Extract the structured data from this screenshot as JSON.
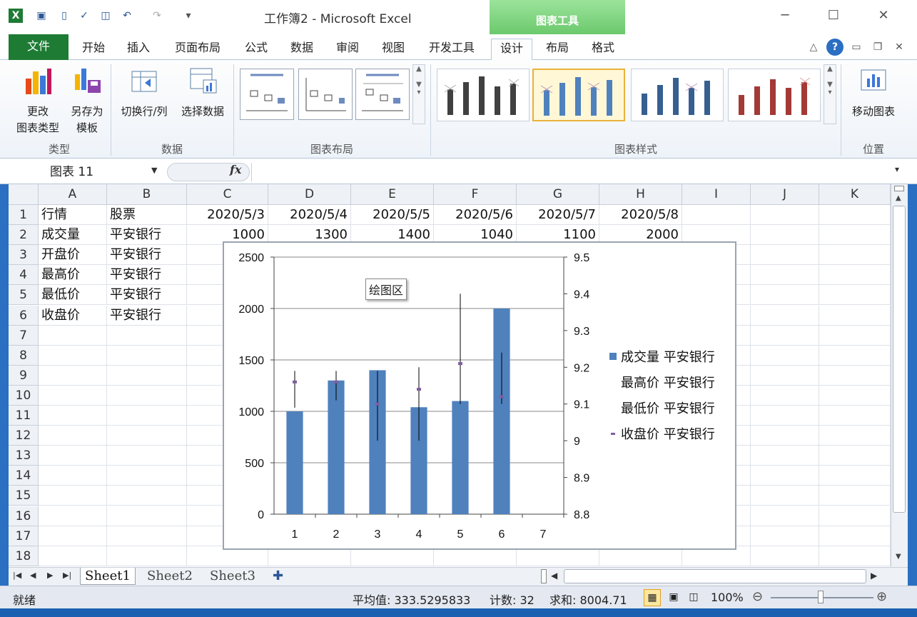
{
  "window": {
    "title": "工作簿2 - Microsoft Excel",
    "context_tab": "图表工具"
  },
  "ribbon_tabs": [
    "文件",
    "开始",
    "插入",
    "页面布局",
    "公式",
    "数据",
    "审阅",
    "视图",
    "开发工具",
    "设计",
    "布局",
    "格式"
  ],
  "active_tab": "设计",
  "ribbon": {
    "type_group": {
      "label": "类型",
      "change_type": [
        "更改",
        "图表类型"
      ],
      "save_template": [
        "另存为",
        "模板"
      ]
    },
    "data_group": {
      "label": "数据",
      "switch": "切换行/列",
      "select": "选择数据"
    },
    "layout_group": {
      "label": "图表布局"
    },
    "style_group": {
      "label": "图表样式"
    },
    "position_group": {
      "label": "位置",
      "move": "移动图表"
    }
  },
  "formula_bar": {
    "name_box": "图表 11",
    "fx": "fx",
    "formula": ""
  },
  "columns": [
    "A",
    "B",
    "C",
    "D",
    "E",
    "F",
    "G",
    "H",
    "I",
    "J",
    "K"
  ],
  "rows": [
    "1",
    "2",
    "3",
    "4",
    "5",
    "6",
    "7",
    "8",
    "9",
    "10",
    "11",
    "12",
    "13",
    "14",
    "15",
    "16",
    "17",
    "18"
  ],
  "cells": {
    "r1": [
      "行情",
      "股票",
      "2020/5/3",
      "2020/5/4",
      "2020/5/5",
      "2020/5/6",
      "2020/5/7",
      "2020/5/8"
    ],
    "r2": [
      "成交量",
      "平安银行",
      "1000",
      "1300",
      "1400",
      "1040",
      "1100",
      "2000"
    ],
    "r3": [
      "开盘价",
      "平安银行"
    ],
    "r4": [
      "最高价",
      "平安银行"
    ],
    "r5": [
      "最低价",
      "平安银行"
    ],
    "r6": [
      "收盘价",
      "平安银行"
    ]
  },
  "chart_data": {
    "type": "bar",
    "categories": [
      "1",
      "2",
      "3",
      "4",
      "5",
      "6",
      "7"
    ],
    "series": [
      {
        "name": "成交量 平安银行",
        "axis": "left",
        "values": [
          1000,
          1300,
          1400,
          1040,
          1100,
          2000,
          null
        ],
        "color": "#4f81bd"
      },
      {
        "name": "最高价 平安银行",
        "axis": "right",
        "values": [
          9.19,
          9.19,
          9.19,
          9.2,
          9.4,
          9.24,
          null
        ]
      },
      {
        "name": "最低价 平安银行",
        "axis": "right",
        "values": [
          9.09,
          9.11,
          9.0,
          9.0,
          9.1,
          9.1,
          null
        ]
      },
      {
        "name": "收盘价 平安银行",
        "axis": "right",
        "values": [
          9.16,
          9.16,
          9.1,
          9.14,
          9.21,
          9.12,
          null
        ],
        "color": "#7f5ea0"
      }
    ],
    "left_axis": {
      "ylim": [
        0,
        2500
      ],
      "ticks": [
        "0",
        "500",
        "1000",
        "1500",
        "2000",
        "2500"
      ]
    },
    "right_axis": {
      "ylim": [
        8.8,
        9.5
      ],
      "ticks": [
        "8.8",
        "8.9",
        "9",
        "9.1",
        "9.2",
        "9.3",
        "9.4",
        "9.5"
      ]
    },
    "legend_position": "right",
    "grid": true,
    "tooltip": "绘图区"
  },
  "sheets": [
    "Sheet1",
    "Sheet2",
    "Sheet3"
  ],
  "active_sheet": "Sheet1",
  "status": {
    "mode": "就绪",
    "average": "平均值: 333.5295833",
    "count": "计数: 32",
    "sum": "求和: 8004.71",
    "zoom": "100%"
  }
}
